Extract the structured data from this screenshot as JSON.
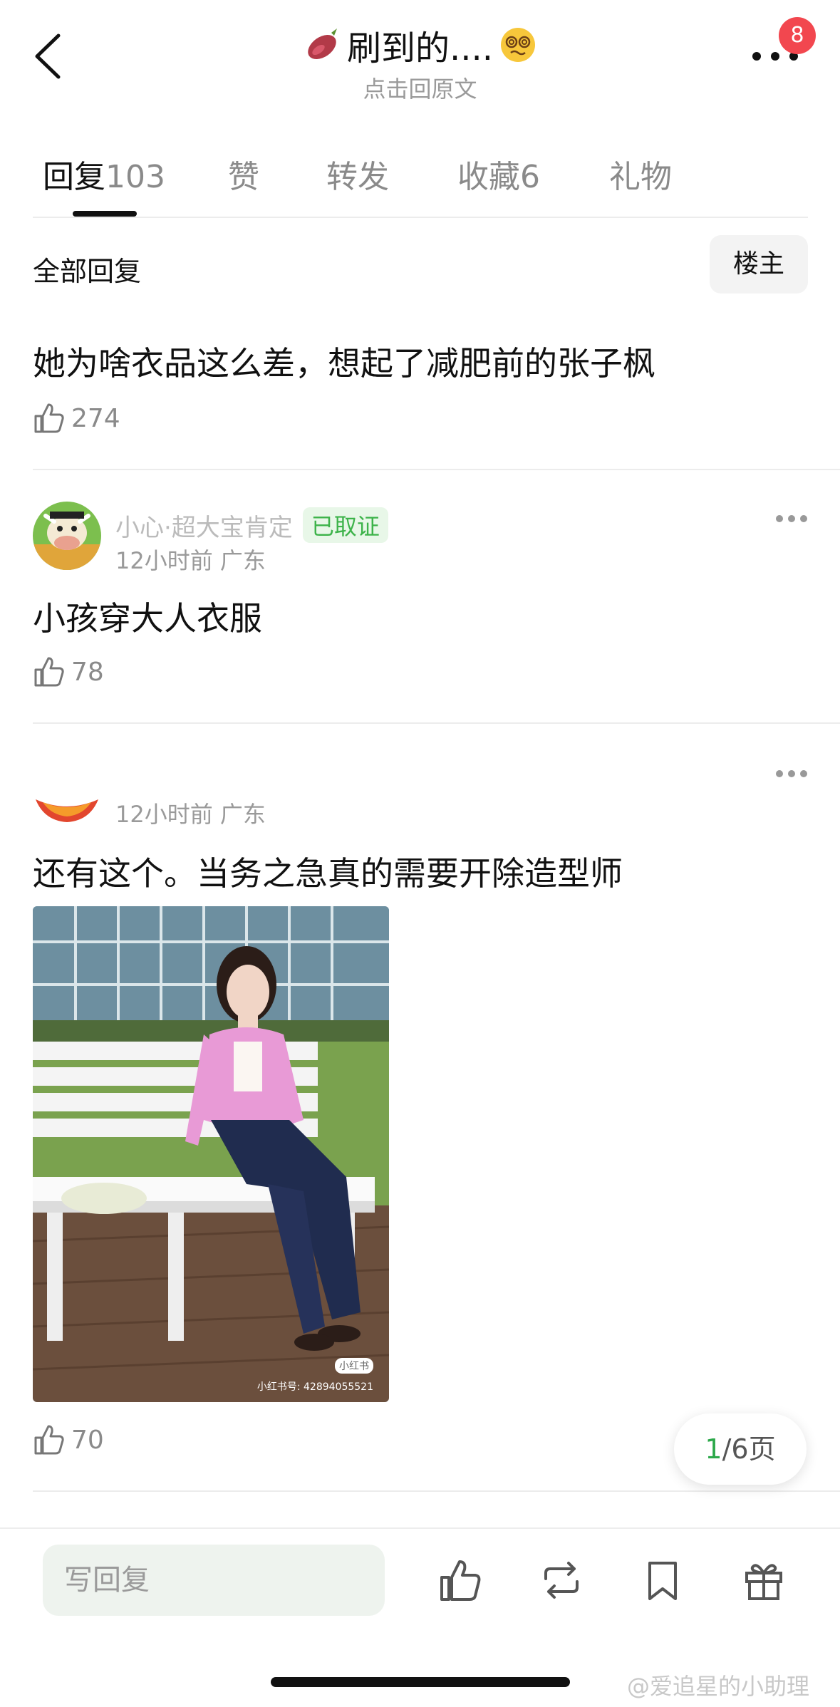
{
  "header": {
    "title": "刷到的....",
    "subtitle": "点击回原文",
    "notification_count": "8"
  },
  "tabs": [
    {
      "label": "回复",
      "count": "103",
      "active": true
    },
    {
      "label": "赞",
      "count": ""
    },
    {
      "label": "转发",
      "count": ""
    },
    {
      "label": "收藏",
      "count": "6"
    },
    {
      "label": "礼物",
      "count": ""
    }
  ],
  "filter": {
    "label": "全部回复",
    "button": "楼主"
  },
  "comments": [
    {
      "text": "她为啥衣品这么差，想起了减肥前的张子枫",
      "likes": "274"
    },
    {
      "name": "小心·超大宝肯定",
      "verified": "已取证",
      "meta": "12小时前 广东",
      "text": "小孩穿大人衣服",
      "likes": "78"
    },
    {
      "meta": "12小时前 广东",
      "text": "还有这个。当务之急真的需要开除造型师",
      "photo_caption": "小红书号: 42894055521",
      "photo_logo": "小红书",
      "likes": "70"
    }
  ],
  "pager": {
    "current": "1",
    "total": "/6页"
  },
  "bottom": {
    "reply_placeholder": "写回复"
  },
  "watermark": "@爱追星的小助理"
}
